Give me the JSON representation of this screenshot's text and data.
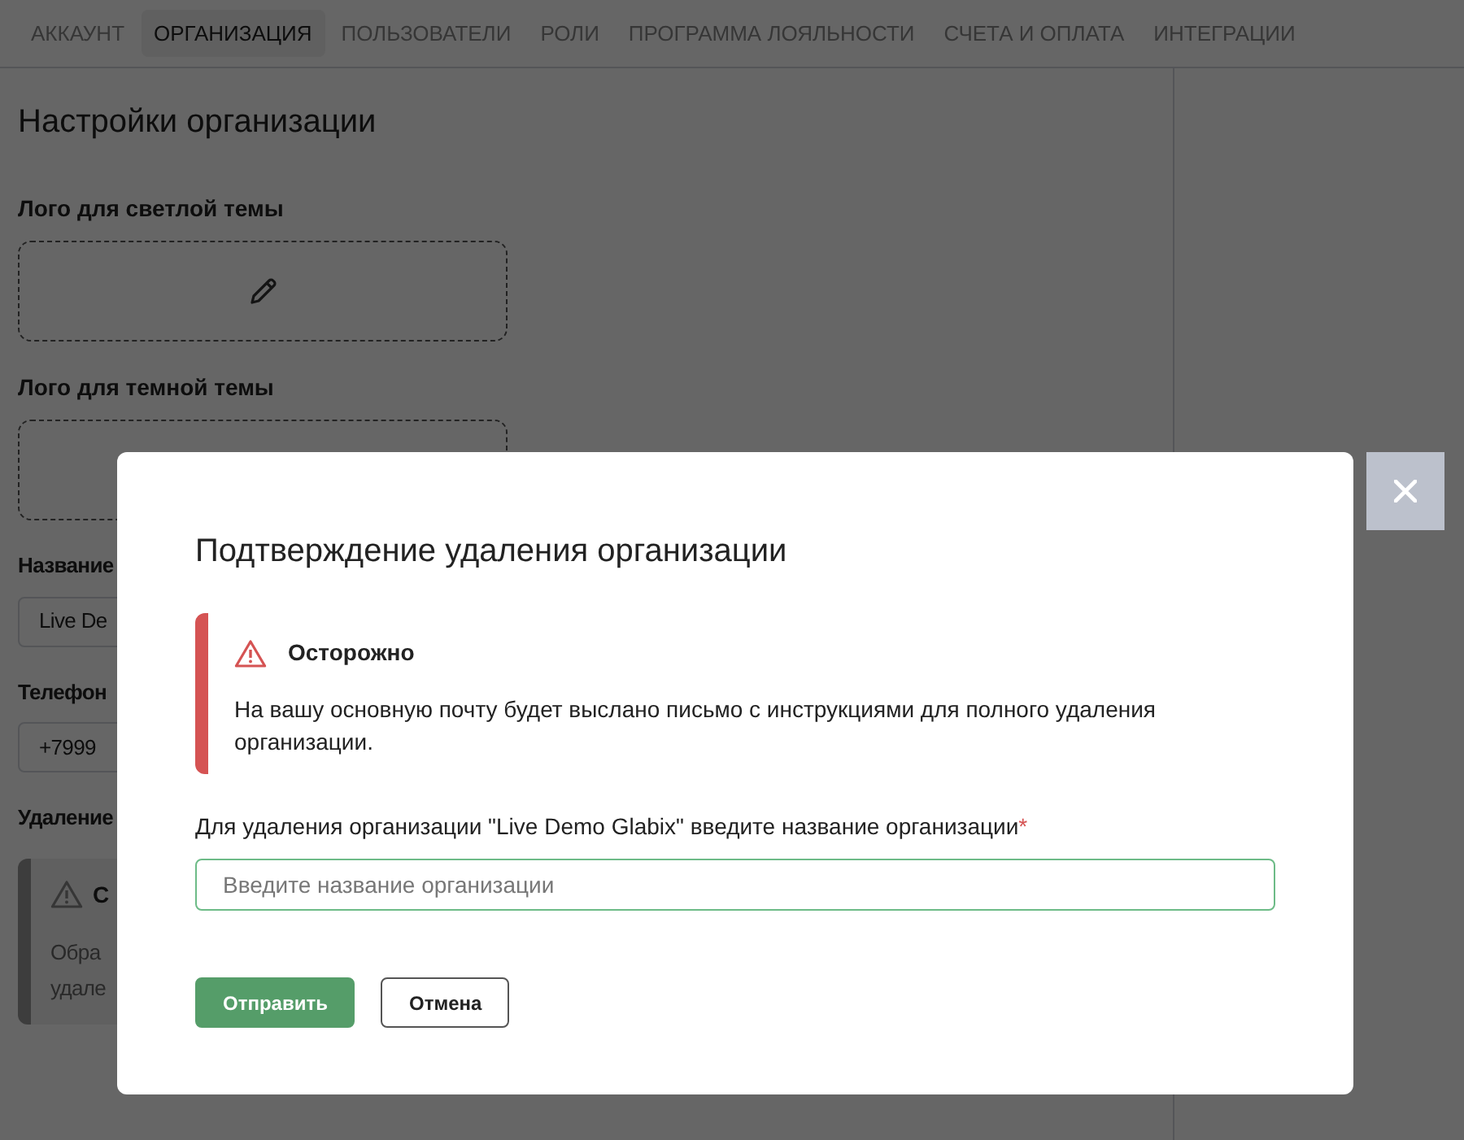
{
  "tabs": [
    {
      "label": "АККАУНТ",
      "selected": false
    },
    {
      "label": "ОРГАНИЗАЦИЯ",
      "selected": true
    },
    {
      "label": "ПОЛЬЗОВАТЕЛИ",
      "selected": false
    },
    {
      "label": "РОЛИ",
      "selected": false
    },
    {
      "label": "ПРОГРАММА ЛОЯЛЬНОСТИ",
      "selected": false
    },
    {
      "label": "СЧЕТА И ОПЛАТА",
      "selected": false
    },
    {
      "label": "ИНТЕГРАЦИИ",
      "selected": false
    }
  ],
  "page": {
    "title": "Настройки организации",
    "logos": [
      {
        "label": "Лого для светлой темы"
      },
      {
        "label": "Лого для темной темы"
      }
    ],
    "fields": [
      {
        "label": "Название",
        "value": "Live De"
      },
      {
        "label": "Телефон",
        "value": "+7999"
      }
    ],
    "deletion": {
      "title": "Удаление",
      "notice_title": "С",
      "notice_lines": [
        "Обра",
        "удале"
      ]
    }
  },
  "dialog": {
    "title": "Подтверждение удаления организации",
    "alert": {
      "kind": "warning",
      "title": "Осторожно",
      "text": "На вашу основную почту будет выслано письмо с инструкциями для полного удаления организации."
    },
    "field": {
      "label": "Для удаления организации \"Live Demo Glabix\" введите название организации",
      "required_mark": "*",
      "placeholder": "Введите название организации"
    },
    "buttons": [
      {
        "label": "Отправить",
        "kind": "primary"
      },
      {
        "label": "Отмена",
        "kind": "secondary"
      }
    ]
  }
}
